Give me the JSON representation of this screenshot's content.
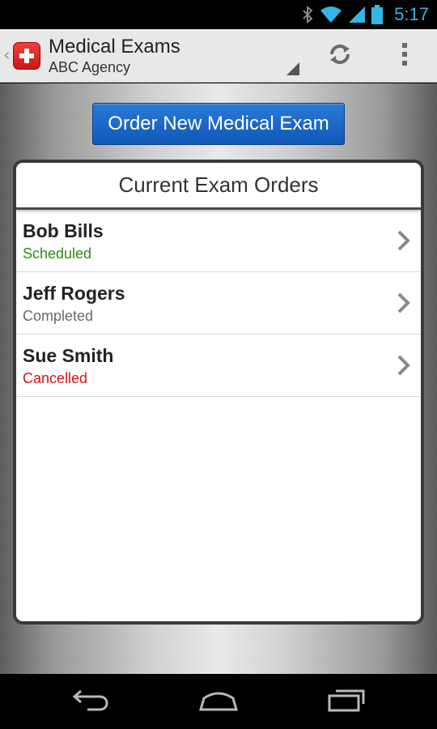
{
  "status_bar": {
    "time": "5:17",
    "icons": [
      "bluetooth-icon",
      "wifi-icon",
      "signal-icon",
      "battery-icon"
    ],
    "accent_color": "#33b5e5"
  },
  "action_bar": {
    "title": "Medical Exams",
    "subtitle": "ABC Agency",
    "app_icon": "red-cross-icon",
    "actions": [
      "refresh-icon",
      "overflow-menu-icon"
    ]
  },
  "main": {
    "order_button_label": "Order New Medical Exam",
    "panel_title": "Current Exam Orders",
    "orders": [
      {
        "name": "Bob Bills",
        "status": "Scheduled",
        "status_color": "#2e8b12"
      },
      {
        "name": "Jeff Rogers",
        "status": "Completed",
        "status_color": "#6a6a6a"
      },
      {
        "name": "Sue Smith",
        "status": "Cancelled",
        "status_color": "#e01010"
      }
    ]
  },
  "nav_bar": {
    "buttons": [
      "back-icon",
      "home-icon",
      "recent-apps-icon"
    ]
  }
}
